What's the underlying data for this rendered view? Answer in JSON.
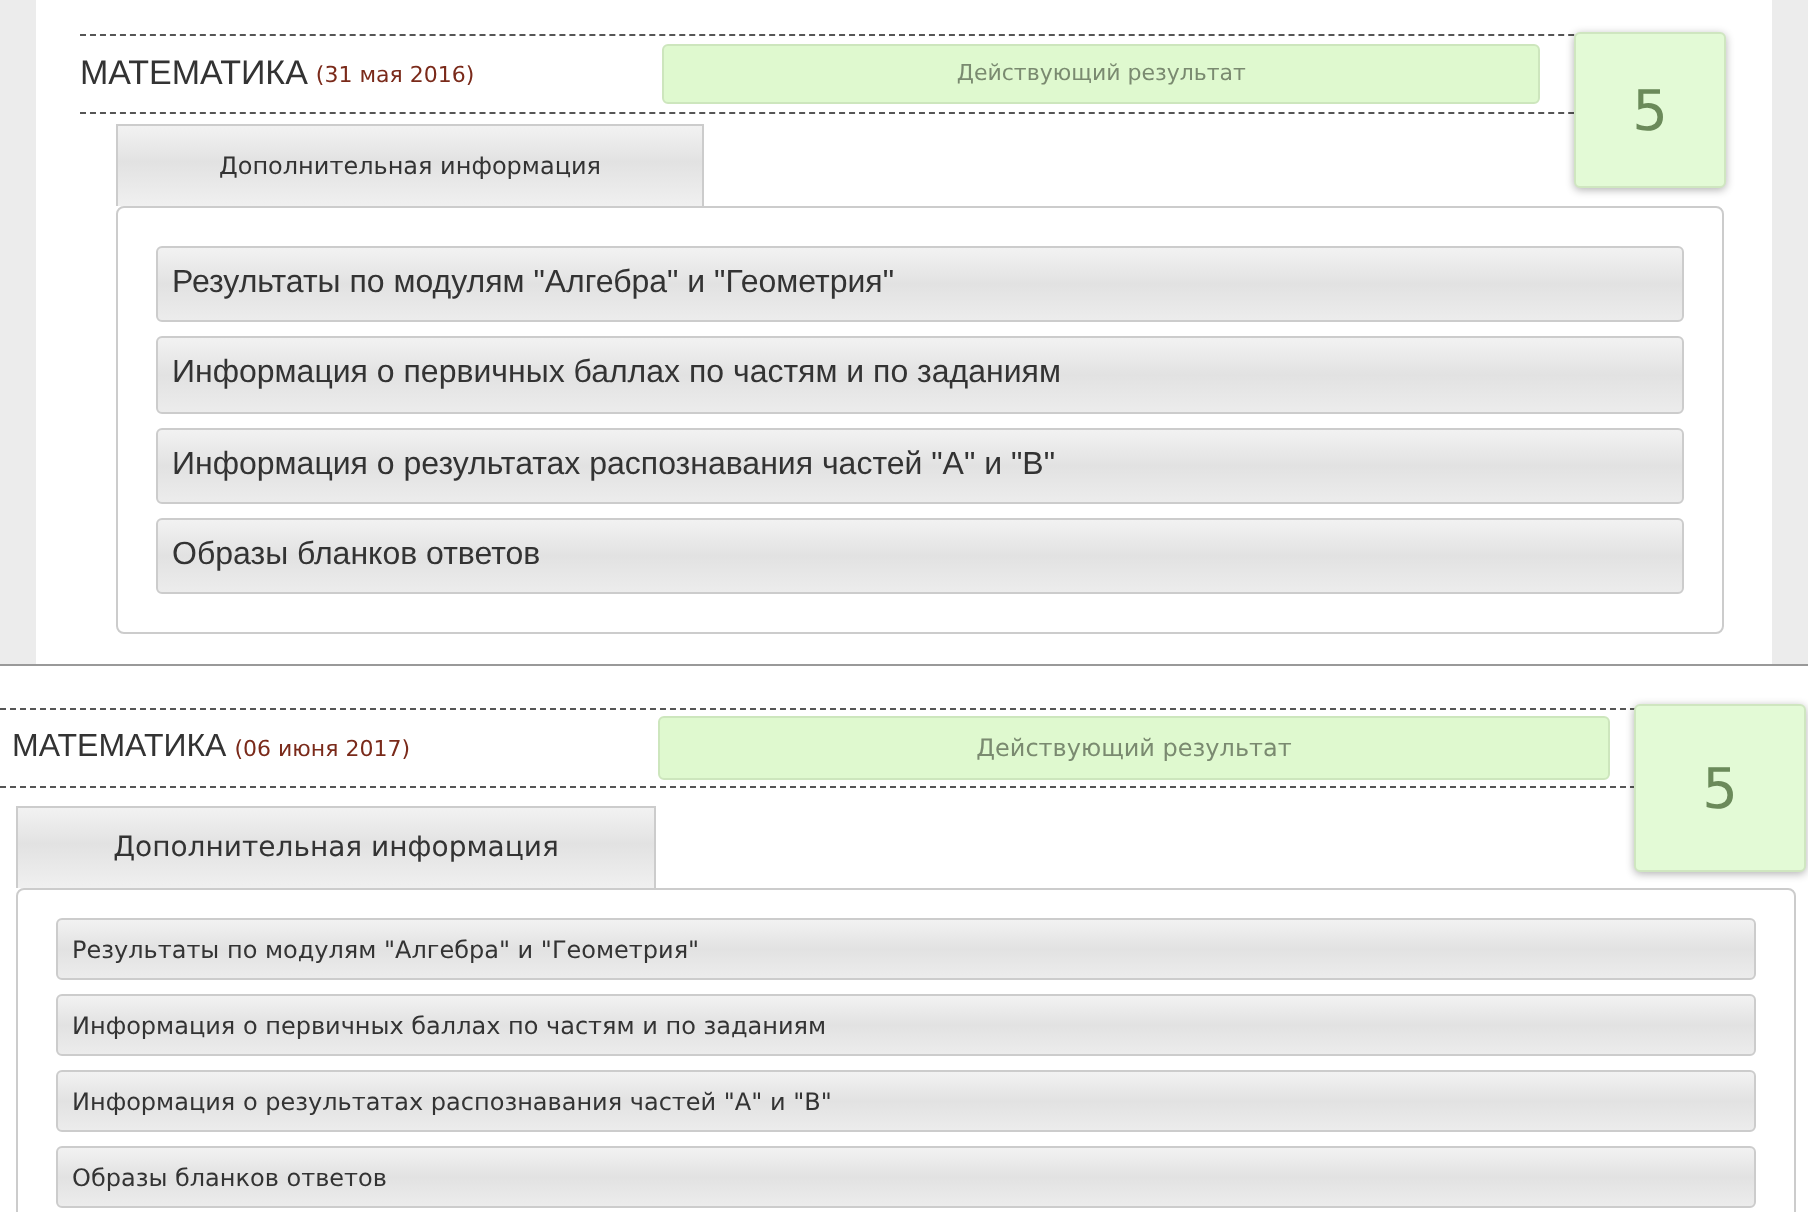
{
  "sections": [
    {
      "kind": "large",
      "subject": "МАТЕМАТИКА",
      "date": "(31 мая 2016)",
      "status": "Действующий результат",
      "grade": "5",
      "tabs": [
        {
          "label": "Дополнительная информация",
          "selected": true
        }
      ],
      "items": [
        "Результаты по модулям \"Алгебра\" и \"Геометрия\"",
        "Информация о первичных баллах по частям и по заданиям",
        "Информация о результатах распознавания частей \"А\" и \"В\"",
        "Образы бланков ответов"
      ]
    },
    {
      "kind": "compact",
      "subject": "МАТЕМАТИКА",
      "date": "(06 июня 2017)",
      "status": "Действующий результат",
      "grade": "5",
      "tabs": [
        {
          "label": "Дополнительная информация",
          "selected": true
        }
      ],
      "items": [
        "Результаты по модулям \"Алгебра\" и \"Геометрия\"",
        "Информация о первичных баллах по частям и по заданиям",
        "Информация о результатах распознавания частей \"А\" и \"В\"",
        "Образы бланков ответов"
      ]
    }
  ]
}
